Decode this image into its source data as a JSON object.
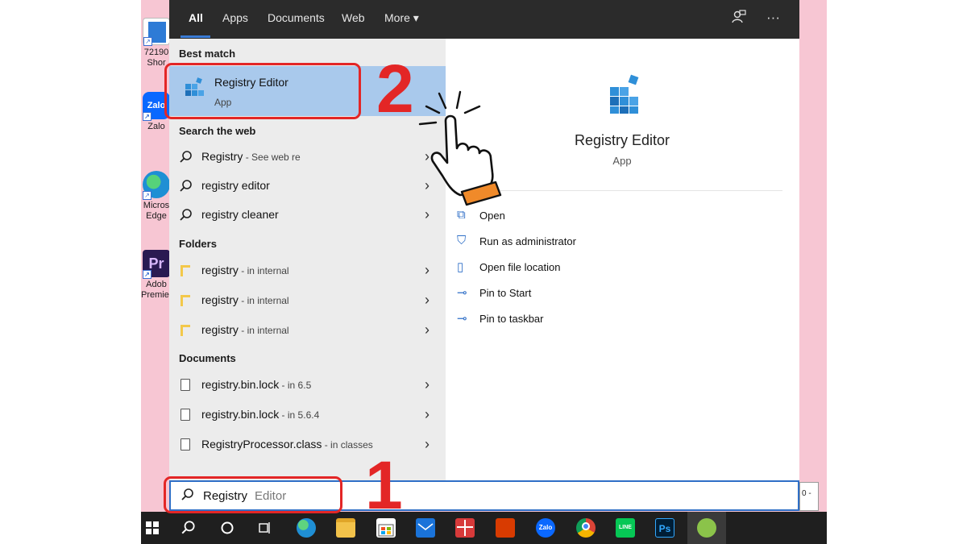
{
  "desktop": {
    "icons": [
      {
        "label": "72190",
        "label2": "Shor",
        "color": "#2e7bd6",
        "glyph": ""
      },
      {
        "label": "Zalo",
        "label2": "",
        "color": "#0a68ff",
        "glyph": "Zalo"
      },
      {
        "label": "Micros",
        "label2": "Edge",
        "color": "#1f8fd4",
        "glyph": ""
      },
      {
        "label": "Adob",
        "label2": "Premiere",
        "color": "#2a1a52",
        "glyph": "Pr"
      }
    ]
  },
  "tabs": {
    "all": "All",
    "apps": "Apps",
    "documents": "Documents",
    "web": "Web",
    "more": "More ▾"
  },
  "top_icons": {
    "feedback": "feedback-icon",
    "more": "···"
  },
  "best_match": {
    "header": "Best match",
    "title": "Registry Editor",
    "type": "App"
  },
  "search_web": {
    "header": "Search the web",
    "items": [
      {
        "main": "Registry",
        "sub": " - See web re"
      },
      {
        "main": "registry editor",
        "sub": ""
      },
      {
        "main": "registry cleaner",
        "sub": ""
      }
    ]
  },
  "folders": {
    "header": "Folders",
    "items": [
      {
        "main": "registry",
        "sub": " - in internal"
      },
      {
        "main": "registry",
        "sub": " - in internal"
      },
      {
        "main": "registry",
        "sub": " - in internal"
      }
    ]
  },
  "documents": {
    "header": "Documents",
    "items": [
      {
        "main": "registry.bin.lock",
        "sub": " - in 6.5"
      },
      {
        "main": "registry.bin.lock",
        "sub": " - in 5.6.4"
      },
      {
        "main": "RegistryProcessor.class",
        "sub": " - in classes"
      }
    ]
  },
  "preview": {
    "title": "Registry Editor",
    "type": "App",
    "actions": [
      {
        "label": "Open",
        "icon": "open-icon"
      },
      {
        "label": "Run as administrator",
        "icon": "shield-icon"
      },
      {
        "label": "Open file location",
        "icon": "folder-location-icon"
      },
      {
        "label": "Pin to Start",
        "icon": "pin-icon"
      },
      {
        "label": "Pin to taskbar",
        "icon": "pin-icon"
      }
    ]
  },
  "search": {
    "typed": "Registry",
    "completion": " Editor",
    "value": "Registry"
  },
  "side_box_text": "0 -",
  "taskbar": {
    "items": [
      "start",
      "search",
      "cortana",
      "task-view",
      "edge",
      "file-explorer",
      "store",
      "mail",
      "gift",
      "office",
      "zalo",
      "chrome",
      "line",
      "photoshop",
      "app"
    ],
    "zalo_label": "Zalo",
    "line_label": "LINE",
    "ps_label": "Ps"
  },
  "annotations": {
    "step1": "1",
    "step2": "2"
  }
}
